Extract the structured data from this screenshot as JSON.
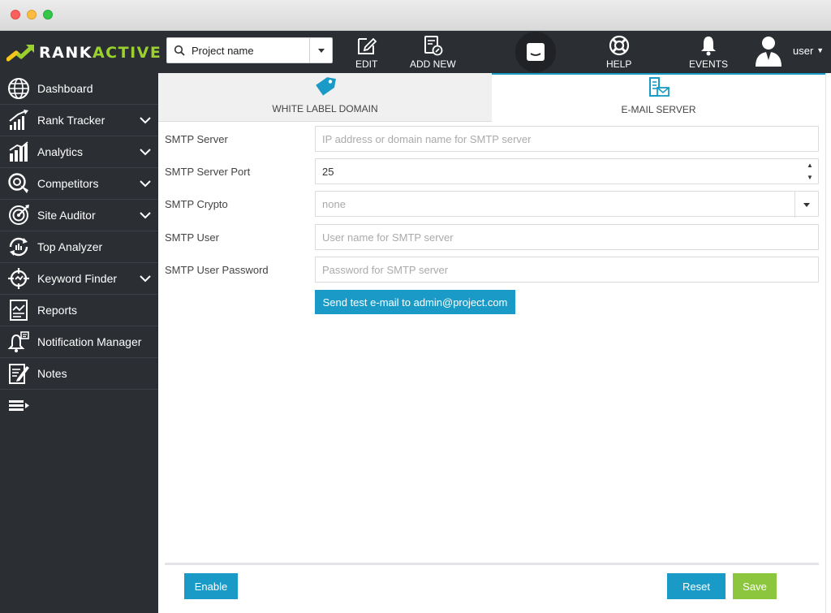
{
  "header": {
    "logo": {
      "rank": "RANK",
      "active": "ACTIVE"
    },
    "project_select": {
      "value": "Project name"
    },
    "tools": {
      "edit": "EDIT",
      "add_new": "ADD NEW",
      "help": "HELP",
      "events": "EVENTS"
    },
    "user": "user"
  },
  "sidebar": {
    "items": [
      {
        "label": "Dashboard",
        "icon": "globe-icon",
        "expandable": false
      },
      {
        "label": "Rank Tracker",
        "icon": "rank-chart-icon",
        "expandable": true
      },
      {
        "label": "Analytics",
        "icon": "analytics-icon",
        "expandable": true
      },
      {
        "label": "Competitors",
        "icon": "competitors-icon",
        "expandable": true
      },
      {
        "label": "Site Auditor",
        "icon": "auditor-icon",
        "expandable": true
      },
      {
        "label": "Top Analyzer",
        "icon": "analyzer-icon",
        "expandable": false
      },
      {
        "label": "Keyword Finder",
        "icon": "crosshair-icon",
        "expandable": true
      },
      {
        "label": "Reports",
        "icon": "reports-icon",
        "expandable": false
      },
      {
        "label": "Notification Manager",
        "icon": "bell-icon",
        "expandable": false
      },
      {
        "label": "Notes",
        "icon": "notes-icon",
        "expandable": false
      }
    ]
  },
  "tabs": [
    {
      "label": "WHITE LABEL DOMAIN",
      "icon": "tag-icon",
      "active": false
    },
    {
      "label": "E-MAIL SERVER",
      "icon": "mail-server-icon",
      "active": true
    }
  ],
  "form": {
    "smtp_server": {
      "label": "SMTP Server",
      "value": "",
      "placeholder": "IP address or domain name for SMTP server"
    },
    "smtp_port": {
      "label": "SMTP Server Port",
      "value": "25"
    },
    "smtp_crypto": {
      "label": "SMTP Crypto",
      "value": "none"
    },
    "smtp_user": {
      "label": "SMTP User",
      "value": "",
      "placeholder": "User name for SMTP server"
    },
    "smtp_password": {
      "label": "SMTP User Password",
      "value": "",
      "placeholder": "Password for SMTP server"
    },
    "test_button": "Send test e-mail to admin@project.com"
  },
  "footer": {
    "enable": "Enable",
    "reset": "Reset",
    "save": "Save"
  },
  "colors": {
    "accent": "#1a9bc7",
    "brand_green": "#9bd12e",
    "save_green": "#8cc63f",
    "sidebar_bg": "#2b2e33"
  }
}
